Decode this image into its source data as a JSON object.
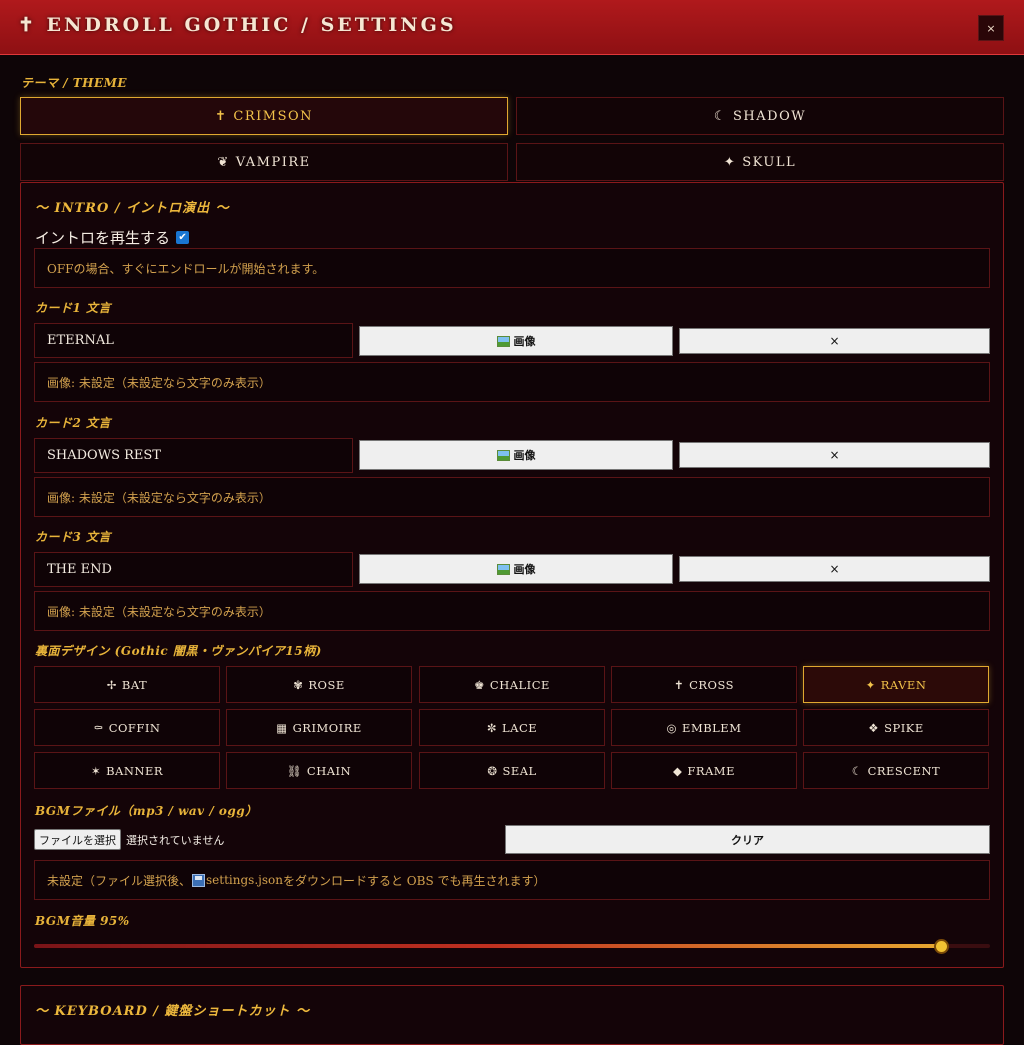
{
  "window": {
    "title": "✝ ENDROLL GOTHIC / SETTINGS",
    "close_label": "×"
  },
  "theme": {
    "label": "テーマ / THEME",
    "options": [
      {
        "icon": "✝",
        "label": "CRIMSON",
        "active": true
      },
      {
        "icon": "☾",
        "label": "SHADOW",
        "active": false
      },
      {
        "icon": "❦",
        "label": "VAMPIRE",
        "active": false
      },
      {
        "icon": "✦",
        "label": "SKULL",
        "active": false
      }
    ]
  },
  "intro": {
    "title": "〜 INTRO / イントロ演出 〜",
    "play_label": "イントロを再生する",
    "play_checked": true,
    "check_mark": "✔",
    "play_note": "OFFの場合、すぐにエンドロールが開始されます。",
    "cards": [
      {
        "label": "カード1 文言",
        "value": "ETERNAL",
        "image_button": "画像",
        "clear_button": "×",
        "image_status": "画像: 未設定（未設定なら文字のみ表示）"
      },
      {
        "label": "カード2 文言",
        "value": "SHADOWS REST",
        "image_button": "画像",
        "clear_button": "×",
        "image_status": "画像: 未設定（未設定なら文字のみ表示）"
      },
      {
        "label": "カード3 文言",
        "value": "THE END",
        "image_button": "画像",
        "clear_button": "×",
        "image_status": "画像: 未設定（未設定なら文字のみ表示）"
      }
    ],
    "design_label": "裏面デザイン (Gothic 闇黒・ヴァンパイア15柄)",
    "designs": [
      {
        "icon": "✢",
        "label": "BAT",
        "active": false
      },
      {
        "icon": "✾",
        "label": "ROSE",
        "active": false
      },
      {
        "icon": "♚",
        "label": "CHALICE",
        "active": false
      },
      {
        "icon": "✝",
        "label": "CROSS",
        "active": false
      },
      {
        "icon": "✦",
        "label": "RAVEN",
        "active": true
      },
      {
        "icon": "⚰",
        "label": "COFFIN",
        "active": false
      },
      {
        "icon": "▦",
        "label": "GRIMOIRE",
        "active": false
      },
      {
        "icon": "✼",
        "label": "LACE",
        "active": false
      },
      {
        "icon": "◎",
        "label": "EMBLEM",
        "active": false
      },
      {
        "icon": "❖",
        "label": "SPIKE",
        "active": false
      },
      {
        "icon": "✶",
        "label": "BANNER",
        "active": false
      },
      {
        "icon": "⛓",
        "label": "CHAIN",
        "active": false
      },
      {
        "icon": "❂",
        "label": "SEAL",
        "active": false
      },
      {
        "icon": "◆",
        "label": "FRAME",
        "active": false
      },
      {
        "icon": "☾",
        "label": "CRESCENT",
        "active": false
      }
    ],
    "bgm": {
      "label": "BGMファイル（mp3 / wav / ogg）",
      "file_button": "ファイルを選択",
      "file_status": "選択されていません",
      "clear_button": "クリア",
      "note_prefix": "未設定（ファイル選択後、",
      "note_file": "settings.json",
      "note_suffix": " をダウンロードすると OBS でも再生されます）",
      "volume_label": "BGM音量 95%",
      "volume_fraction": 0.95
    }
  },
  "keyboard": {
    "title": "〜 KEYBOARD / 鍵盤ショートカット 〜"
  },
  "colors": {
    "accent_gold": "#e8b43a",
    "title_bar": "#a01418",
    "panel_border": "#8a1a1c"
  }
}
